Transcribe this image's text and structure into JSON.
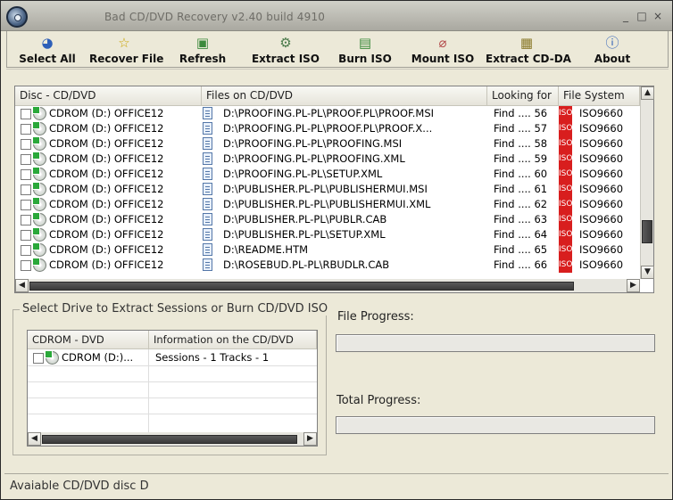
{
  "window": {
    "title": "Bad CD/DVD Recovery v2.40 build 4910",
    "controls": [
      "_",
      "□",
      "×"
    ]
  },
  "toolbar": {
    "buttons": [
      {
        "label": "Select All",
        "icon": "select-all-icon",
        "glyph": "◕"
      },
      {
        "label": "Recover File",
        "icon": "star-icon",
        "glyph": "☆"
      },
      {
        "label": "Refresh",
        "icon": "refresh-icon",
        "glyph": "▣"
      },
      {
        "label": "Extract ISO",
        "icon": "extract-iso-icon",
        "glyph": "⚙"
      },
      {
        "label": "Burn ISO",
        "icon": "burn-iso-icon",
        "glyph": "▤"
      },
      {
        "label": "Mount ISO",
        "icon": "mount-iso-icon",
        "glyph": "⌀"
      },
      {
        "label": "Extract CD-DA",
        "icon": "extract-cdda-icon",
        "glyph": "▦"
      },
      {
        "label": "About",
        "icon": "about-icon",
        "glyph": "ⓘ"
      }
    ]
  },
  "files_list": {
    "columns": [
      "Disc - CD/DVD",
      "Files on CD/DVD",
      "Looking for",
      "File System"
    ],
    "rows": [
      {
        "disc": "CDROM (D:) OFFICE12",
        "file": "D:\\PROOFING.PL-PL\\PROOF.PL\\PROOF.MSI",
        "looking": "Find .... 56",
        "iso": "ISO",
        "fs": "ISO9660"
      },
      {
        "disc": "CDROM (D:) OFFICE12",
        "file": "D:\\PROOFING.PL-PL\\PROOF.PL\\PROOF.X...",
        "looking": "Find .... 57",
        "iso": "ISO",
        "fs": "ISO9660"
      },
      {
        "disc": "CDROM (D:) OFFICE12",
        "file": "D:\\PROOFING.PL-PL\\PROOFING.MSI",
        "looking": "Find .... 58",
        "iso": "ISO",
        "fs": "ISO9660"
      },
      {
        "disc": "CDROM (D:) OFFICE12",
        "file": "D:\\PROOFING.PL-PL\\PROOFING.XML",
        "looking": "Find .... 59",
        "iso": "ISO",
        "fs": "ISO9660"
      },
      {
        "disc": "CDROM (D:) OFFICE12",
        "file": "D:\\PROOFING.PL-PL\\SETUP.XML",
        "looking": "Find .... 60",
        "iso": "ISO",
        "fs": "ISO9660"
      },
      {
        "disc": "CDROM (D:) OFFICE12",
        "file": "D:\\PUBLISHER.PL-PL\\PUBLISHERMUI.MSI",
        "looking": "Find .... 61",
        "iso": "ISO",
        "fs": "ISO9660"
      },
      {
        "disc": "CDROM (D:) OFFICE12",
        "file": "D:\\PUBLISHER.PL-PL\\PUBLISHERMUI.XML",
        "looking": "Find .... 62",
        "iso": "ISO",
        "fs": "ISO9660"
      },
      {
        "disc": "CDROM (D:) OFFICE12",
        "file": "D:\\PUBLISHER.PL-PL\\PUBLR.CAB",
        "looking": "Find .... 63",
        "iso": "ISO",
        "fs": "ISO9660"
      },
      {
        "disc": "CDROM (D:) OFFICE12",
        "file": "D:\\PUBLISHER.PL-PL\\SETUP.XML",
        "looking": "Find .... 64",
        "iso": "ISO",
        "fs": "ISO9660"
      },
      {
        "disc": "CDROM (D:) OFFICE12",
        "file": "D:\\README.HTM",
        "looking": "Find .... 65",
        "iso": "ISO",
        "fs": "ISO9660"
      },
      {
        "disc": "CDROM (D:) OFFICE12",
        "file": "D:\\ROSEBUD.PL-PL\\RBUDLR.CAB",
        "looking": "Find .... 66",
        "iso": "ISO",
        "fs": "ISO9660"
      }
    ]
  },
  "drive_panel": {
    "group_label": "Select Drive to Extract Sessions or Burn CD/DVD ISO",
    "columns": [
      "CDROM - DVD",
      "Information on the CD/DVD"
    ],
    "rows": [
      {
        "drive": "CDROM (D:)...",
        "info": "Sessions - 1  Tracks - 1"
      }
    ]
  },
  "progress": {
    "file_label": "File Progress:",
    "file_value": 0,
    "total_label": "Total Progress:",
    "total_value": 0
  },
  "status": {
    "text": "Avaiable CD/DVD disc D"
  },
  "colors": {
    "iso_badge": "#d81e1e",
    "window_bg": "#ece9d8"
  }
}
